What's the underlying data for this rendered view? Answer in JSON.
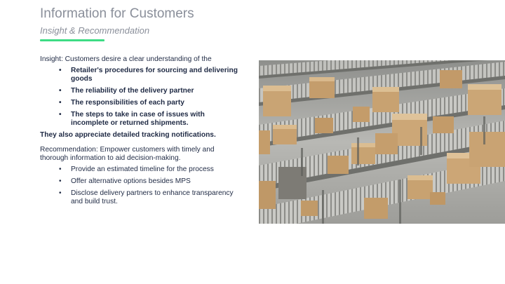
{
  "header": {
    "title": "Information for Customers",
    "subtitle": "Insight & Recommendation",
    "accent_color": "#3ddc84"
  },
  "insight": {
    "intro": "Insight: Customers desire a clear understanding of the",
    "items": [
      "Retailer's procedures for sourcing and delivering goods",
      "The reliability of the delivery partner",
      "The responsibilities of each party",
      "The steps to take in case of issues with incomplete or returned shipments."
    ],
    "also": "They also appreciate detailed tracking notifications."
  },
  "recommendation": {
    "intro": "Recommendation: Empower customers with timely and thorough information to aid decision-making.",
    "items": [
      "Provide an estimated timeline for the process",
      "Offer alternative options besides MPS",
      "Disclose delivery partners to enhance transparency and build trust."
    ]
  },
  "image": {
    "icon": "warehouse-conveyor-boxes-photo"
  }
}
